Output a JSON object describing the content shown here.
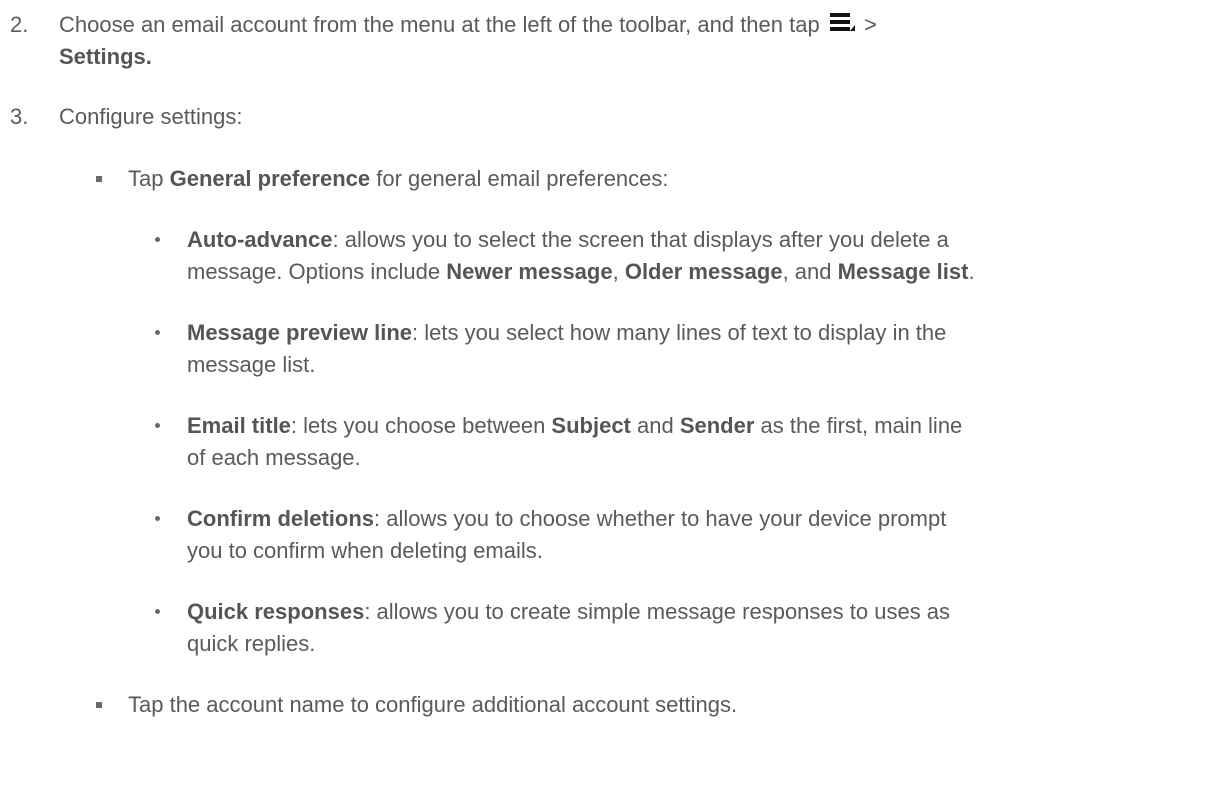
{
  "step2": {
    "number": "2.",
    "line1_before": "Choose an email account from the menu at the left of the toolbar, and then tap",
    "menu_icon": "menu-icon",
    "line1_after": ">",
    "line2_bold": "Settings."
  },
  "step3": {
    "number": "3.",
    "text": "Configure settings:"
  },
  "general_pref": {
    "pre": "Tap ",
    "bold": "General preference",
    "post": " for general email preferences:"
  },
  "items": [
    {
      "bold": "Auto-advance",
      "line1": ": allows you to select the screen that displays after you delete a",
      "line2_pre": "message. Options include ",
      "opt1": "Newer message",
      "sep1": ", ",
      "opt2": "Older message",
      "sep2": ", and ",
      "opt3": "Message list",
      "end": "."
    },
    {
      "bold": "Message preview line",
      "line1": ": lets you select how many lines of text to display in the",
      "line2": "message list."
    },
    {
      "bold": "Email title",
      "line1_a": ": lets you choose between ",
      "opt1": "Subject",
      "line1_b": " and ",
      "opt2": "Sender",
      "line1_c": " as the first, main line",
      "line2": "of each message."
    },
    {
      "bold": "Confirm deletions",
      "line1": ": allows you to choose whether to have your device prompt",
      "line2": "you to confirm when deleting emails."
    },
    {
      "bold": "Quick responses",
      "line1": ": allows you to create simple message responses to uses as",
      "line2": "quick replies."
    }
  ],
  "account_name": {
    "text": "Tap the account name to configure additional account settings."
  }
}
